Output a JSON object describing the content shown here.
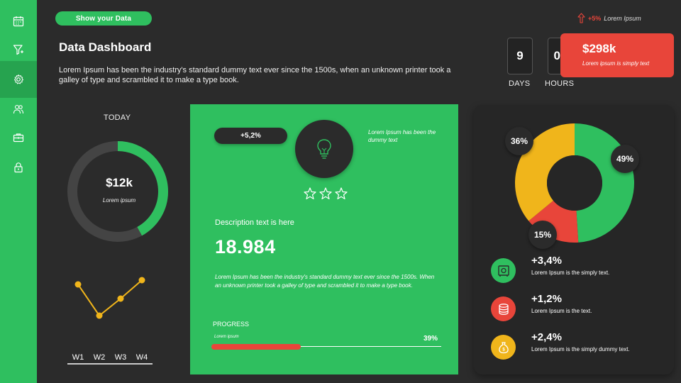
{
  "sidebar": {
    "items": [
      {
        "icon": "calendar-icon"
      },
      {
        "icon": "filter-icon"
      },
      {
        "icon": "settings-icon"
      },
      {
        "icon": "users-icon"
      },
      {
        "icon": "briefcase-icon"
      },
      {
        "icon": "lock-icon"
      }
    ],
    "active_index": 2
  },
  "header": {
    "pill_label": "Show your Data",
    "title": "Data Dashboard",
    "description": "Lorem Ipsum has been the industry's standard dummy text ever since the 1500s, when an unknown printer took a galley of type and scrambled it to make a type book.",
    "trend_pct": "+5%",
    "trend_label": "Lorem Ipsum"
  },
  "countdown": {
    "days_value": "9",
    "days_label": "DAYS",
    "hours_value": "06",
    "hours_label": "HOURS"
  },
  "red_card": {
    "value": "$298k",
    "sub": "Lorem ipsum is simply text"
  },
  "today": {
    "label": "TODAY",
    "value": "$12k",
    "sub": "Lorem ipsum",
    "fraction": 0.42
  },
  "weekly": {
    "labels": [
      "W1",
      "W2",
      "W3",
      "W4"
    ],
    "values": [
      3.2,
      1.0,
      2.2,
      3.5
    ]
  },
  "green_card": {
    "badge": "+5,2%",
    "note": "Lorem Ipsum has been the dummy text",
    "stars": 3,
    "desc_label": "Description text is here",
    "big_value": "18.984",
    "paragraph": "Lorem Ipsum has been the industry's standard dummy text ever since the 1500s. When an unknown printer took a galley of type and scrambled it to make a type book.",
    "progress_title": "PROGRESS",
    "progress_sub": "Lorem ipsum",
    "progress_pct": "39%",
    "progress_value": 0.39
  },
  "breakdown": {
    "slices": [
      {
        "label": "49%",
        "value": 49,
        "color": "#2fbf5f"
      },
      {
        "label": "15%",
        "value": 15,
        "color": "#e8453a"
      },
      {
        "label": "36%",
        "value": 36,
        "color": "#f0b51b"
      }
    ],
    "stats": [
      {
        "value": "+3,4%",
        "text": "Lorem Ipsum is the simply text.",
        "color": "#2fbf5f",
        "icon": "safe-icon"
      },
      {
        "value": "+1,2%",
        "text": "Lorem Ipsum is the text.",
        "color": "#e8453a",
        "icon": "database-icon"
      },
      {
        "value": "+2,4%",
        "text": "Lorem Ipsum is the simply dummy text.",
        "color": "#f0b51b",
        "icon": "money-bag-icon"
      }
    ]
  }
}
